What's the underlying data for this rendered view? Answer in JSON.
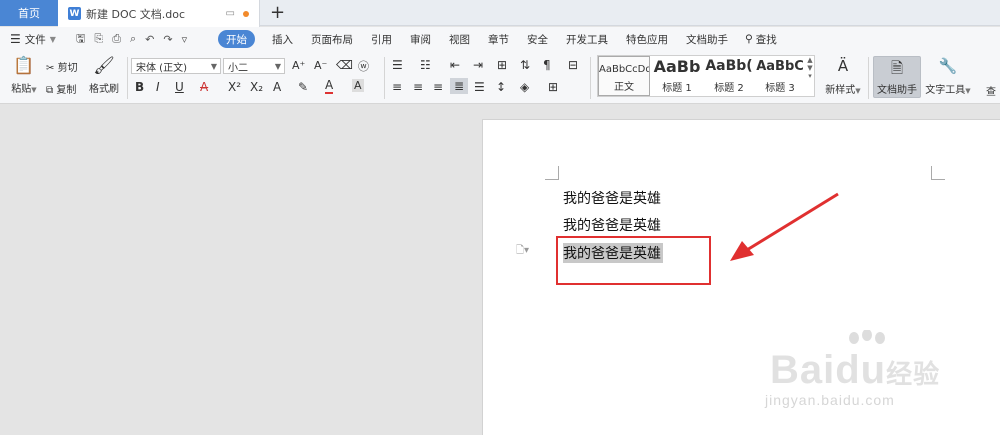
{
  "tabs": {
    "home": "首页",
    "document": "新建 DOC 文档.doc",
    "add": "+"
  },
  "menu": {
    "file": "文件",
    "items": [
      "开始",
      "插入",
      "页面布局",
      "引用",
      "审阅",
      "视图",
      "章节",
      "安全",
      "开发工具",
      "特色应用",
      "文档助手"
    ],
    "search": "查找"
  },
  "ribbon": {
    "paste": "粘贴",
    "cut": "剪切",
    "copy": "复制",
    "format_painter": "格式刷",
    "font_name": "宋体 (正文)",
    "font_size": "小二",
    "styles": [
      {
        "preview": "AaBbCcDd",
        "name": "正文"
      },
      {
        "preview": "AaBb",
        "name": "标题 1"
      },
      {
        "preview": "AaBb(",
        "name": "标题 2"
      },
      {
        "preview": "AaBbC",
        "name": "标题 3"
      }
    ],
    "new_style": "新样式",
    "doc_assistant": "文档助手",
    "text_tools": "文字工具",
    "find_cut": "查"
  },
  "document": {
    "lines": [
      "我的爸爸是英雄",
      "我的爸爸是英雄",
      "我的爸爸是英雄"
    ]
  },
  "watermark": {
    "brand": "Bai",
    "brand2": "du",
    "brand3": "经验",
    "url": "jingyan.baidu.com"
  },
  "colors": {
    "accent": "#4a86d4",
    "highlight_box": "#e03030",
    "selection": "#c8c8c8"
  }
}
